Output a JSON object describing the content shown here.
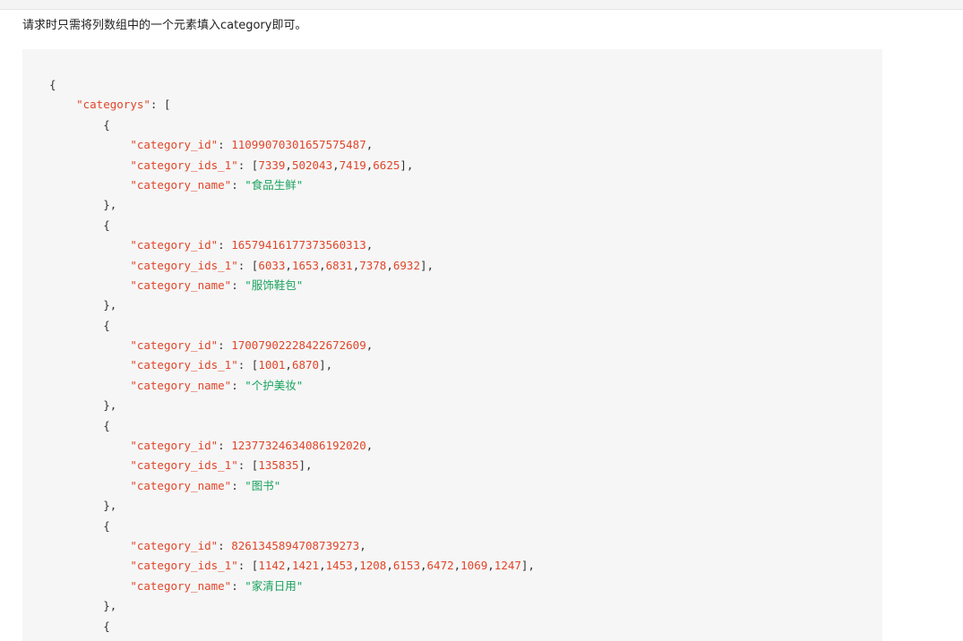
{
  "intro": "请求时只需将列数组中的一个元素填入category即可。",
  "code": {
    "root_key": "\"categorys\"",
    "keys": {
      "id": "\"category_id\"",
      "ids": "\"category_ids_1\"",
      "name": "\"category_name\""
    },
    "items": [
      {
        "id": "11099070301657575487",
        "ids": [
          "7339",
          "502043",
          "7419",
          "6625"
        ],
        "name": "\"食品生鲜\""
      },
      {
        "id": "16579416177373560313",
        "ids": [
          "6033",
          "1653",
          "6831",
          "7378",
          "6932"
        ],
        "name": "\"服饰鞋包\""
      },
      {
        "id": "17007902228422672609",
        "ids": [
          "1001",
          "6870"
        ],
        "name": "\"个护美妆\""
      },
      {
        "id": "12377324634086192020",
        "ids": [
          "135835"
        ],
        "name": "\"图书\""
      },
      {
        "id": "8261345894708739273",
        "ids": [
          "1142",
          "1421",
          "1453",
          "1208",
          "6153",
          "6472",
          "1069",
          "1247"
        ],
        "name": "\"家清日用\""
      }
    ]
  }
}
